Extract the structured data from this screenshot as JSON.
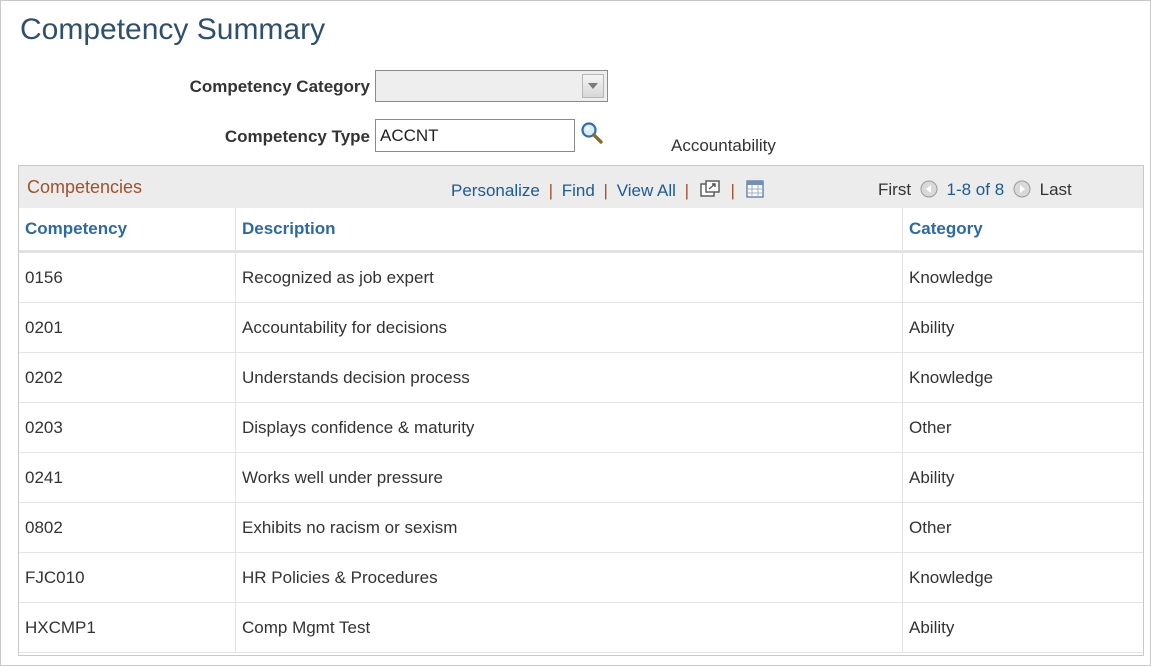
{
  "page": {
    "title": "Competency Summary"
  },
  "criteria": {
    "category_label": "Competency Category",
    "category_value": "",
    "type_label": "Competency Type",
    "type_value": "ACCNT",
    "type_description": "Accountability"
  },
  "grid": {
    "title": "Competencies",
    "nav": {
      "personalize": "Personalize",
      "find": "Find",
      "view_all": "View All",
      "separator": "|"
    },
    "pager": {
      "first": "First",
      "range": "1-8 of 8",
      "last": "Last"
    },
    "columns": [
      "Competency",
      "Description",
      "Category"
    ],
    "rows": [
      {
        "competency": "0156",
        "description": "Recognized as job expert",
        "category": "Knowledge"
      },
      {
        "competency": "0201",
        "description": "Accountability for decisions",
        "category": "Ability"
      },
      {
        "competency": "0202",
        "description": "Understands decision process",
        "category": "Knowledge"
      },
      {
        "competency": "0203",
        "description": "Displays confidence & maturity",
        "category": "Other"
      },
      {
        "competency": "0241",
        "description": "Works well under pressure",
        "category": "Ability"
      },
      {
        "competency": "0802",
        "description": "Exhibits no racism or sexism",
        "category": "Other"
      },
      {
        "competency": "FJC010",
        "description": "HR Policies & Procedures",
        "category": "Knowledge"
      },
      {
        "competency": "HXCMP1",
        "description": "Comp Mgmt Test",
        "category": "Ability"
      }
    ]
  },
  "icons": {
    "lookup": "magnifier-icon",
    "zoom": "new-window-icon",
    "download": "grid-download-icon",
    "prev": "previous-arrow-icon",
    "next": "next-arrow-icon"
  },
  "colors": {
    "title": "#2f4f6f",
    "link": "#1b5b96",
    "grid_title": "#a0522d",
    "column_header": "#2c6aa6"
  }
}
